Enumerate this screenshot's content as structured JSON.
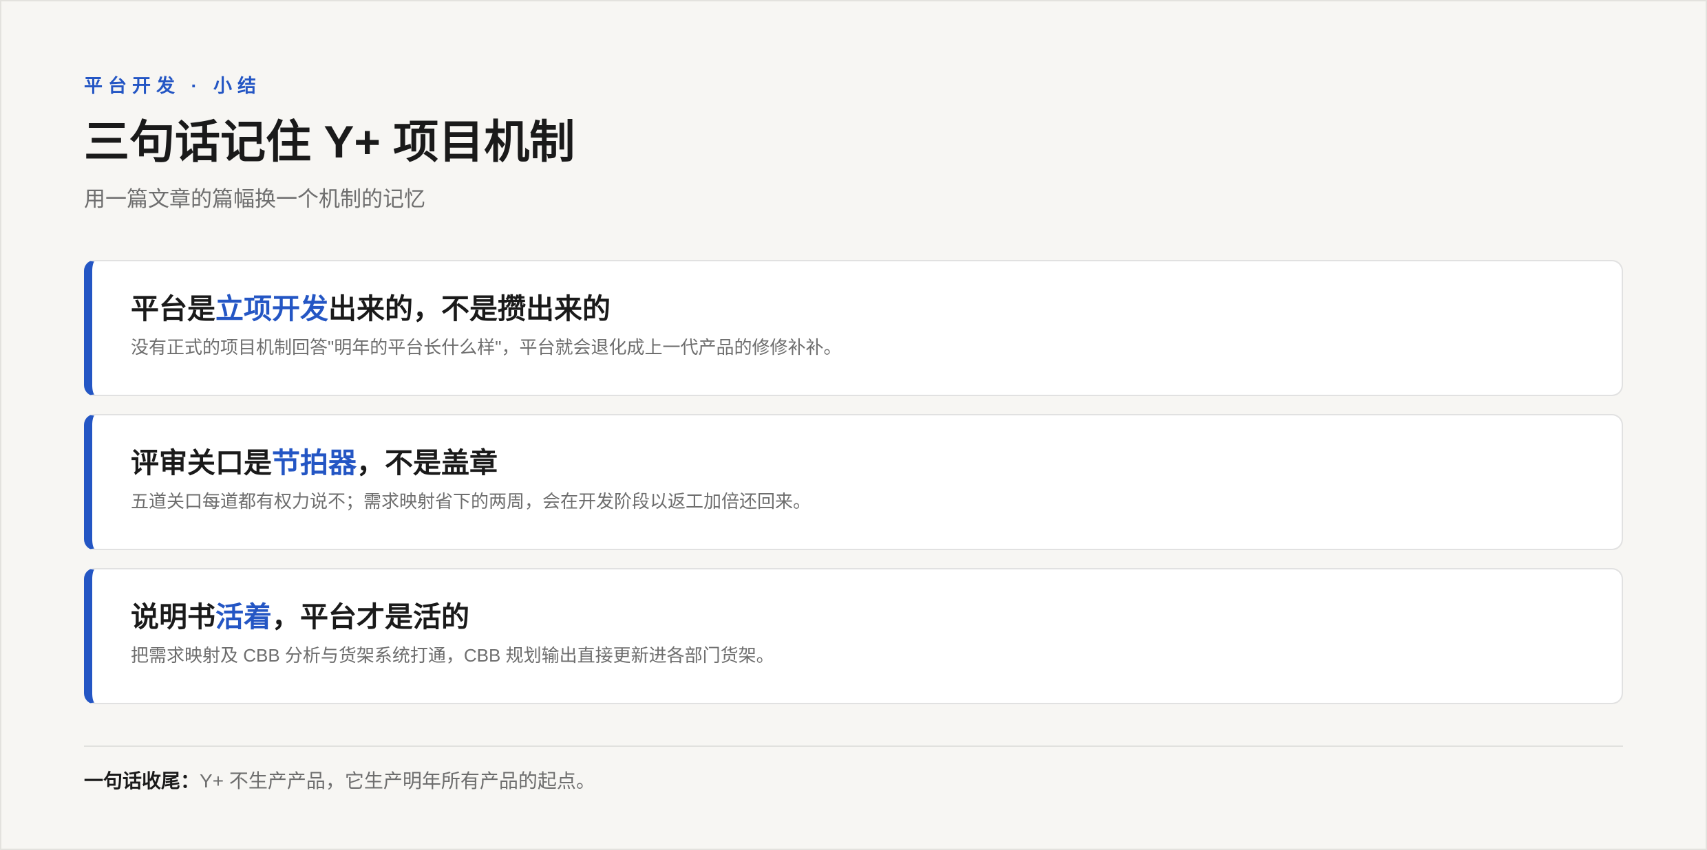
{
  "header": {
    "eyebrow": "平台开发 · 小结",
    "title": "三句话记住 Y+ 项目机制",
    "subtitle": "用一篇文章的篇幅换一个机制的记忆"
  },
  "cards": [
    {
      "heading_before": "平台是",
      "heading_highlight": "立项开发",
      "heading_after": "出来的，不是攒出来的",
      "body": "没有正式的项目机制回答\"明年的平台长什么样\"，平台就会退化成上一代产品的修修补补。"
    },
    {
      "heading_before": "评审关口是",
      "heading_highlight": "节拍器",
      "heading_after": "，不是盖章",
      "body": "五道关口每道都有权力说不；需求映射省下的两周，会在开发阶段以返工加倍还回来。"
    },
    {
      "heading_before": "说明书",
      "heading_highlight": "活着",
      "heading_after": "，平台才是活的",
      "body": "把需求映射及 CBB 分析与货架系统打通，CBB 规划输出直接更新进各部门货架。"
    }
  ],
  "closing": {
    "lead": "一句话收尾：",
    "text": "Y+ 不生产产品，它生产明年所有产品的起点。"
  },
  "colors": {
    "accent": "#2456c4",
    "background": "#f7f6f3",
    "card": "#ffffff",
    "muted_text": "#6e6e6e",
    "text": "#1a1a1a"
  }
}
